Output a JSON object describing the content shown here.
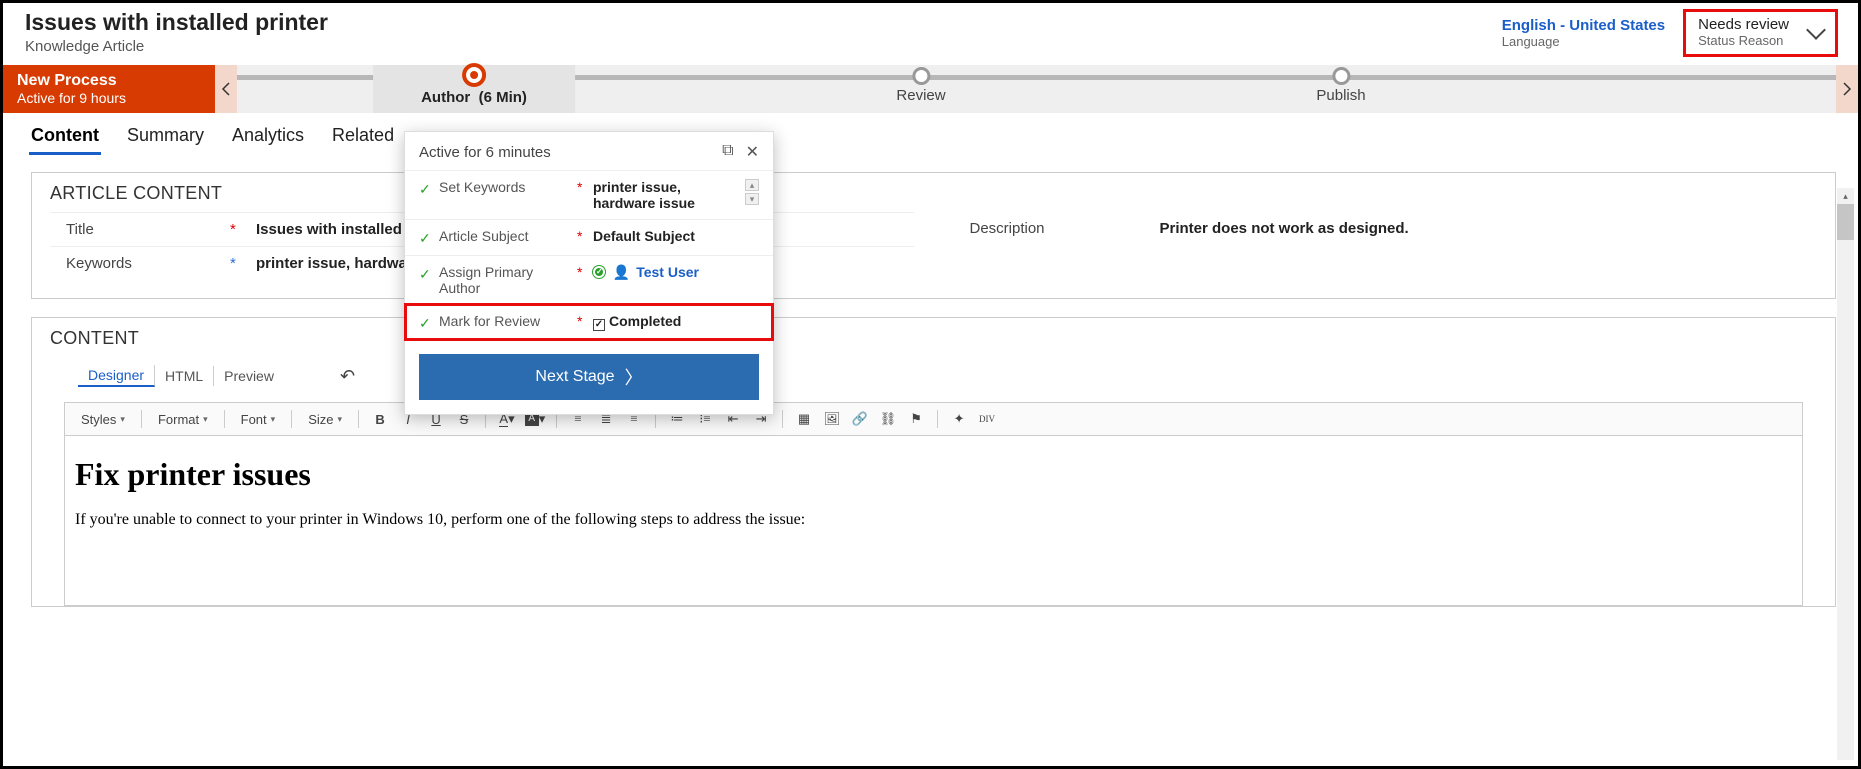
{
  "header": {
    "title": "Issues with installed printer",
    "subtitle": "Knowledge Article",
    "language": {
      "value": "English - United States",
      "label": "Language"
    },
    "status": {
      "value": "Needs review",
      "label": "Status Reason"
    }
  },
  "process": {
    "name": "New Process",
    "active_for": "Active for 9 hours",
    "stages": {
      "author": {
        "label": "Author",
        "duration": "(6 Min)"
      },
      "review": {
        "label": "Review"
      },
      "publish": {
        "label": "Publish"
      }
    }
  },
  "tabs": [
    "Content",
    "Summary",
    "Analytics",
    "Related"
  ],
  "article": {
    "section_title": "ARTICLE CONTENT",
    "fields": {
      "title": {
        "label": "Title",
        "value": "Issues with installed printer"
      },
      "keywords": {
        "label": "Keywords",
        "value": "printer issue, hardware issue"
      },
      "description": {
        "label": "Description",
        "value": "Printer does not work as designed."
      }
    }
  },
  "content": {
    "section_title": "CONTENT",
    "editor_tabs": [
      "Designer",
      "HTML",
      "Preview"
    ],
    "toolbar": {
      "styles": "Styles",
      "format": "Format",
      "font": "Font",
      "size": "Size"
    },
    "body_heading": "Fix printer issues",
    "body_text": "If you're unable to connect to your printer in Windows 10, perform one of the following steps to address the issue:"
  },
  "flyout": {
    "title": "Active for 6 minutes",
    "rows": {
      "keywords": {
        "label": "Set Keywords",
        "value": "printer issue, hardware issue"
      },
      "subject": {
        "label": "Article Subject",
        "value": "Default Subject"
      },
      "author": {
        "label": "Assign Primary Author",
        "value": "Test User"
      },
      "review": {
        "label": "Mark for Review",
        "value": "Completed"
      }
    },
    "next_stage": "Next Stage"
  }
}
